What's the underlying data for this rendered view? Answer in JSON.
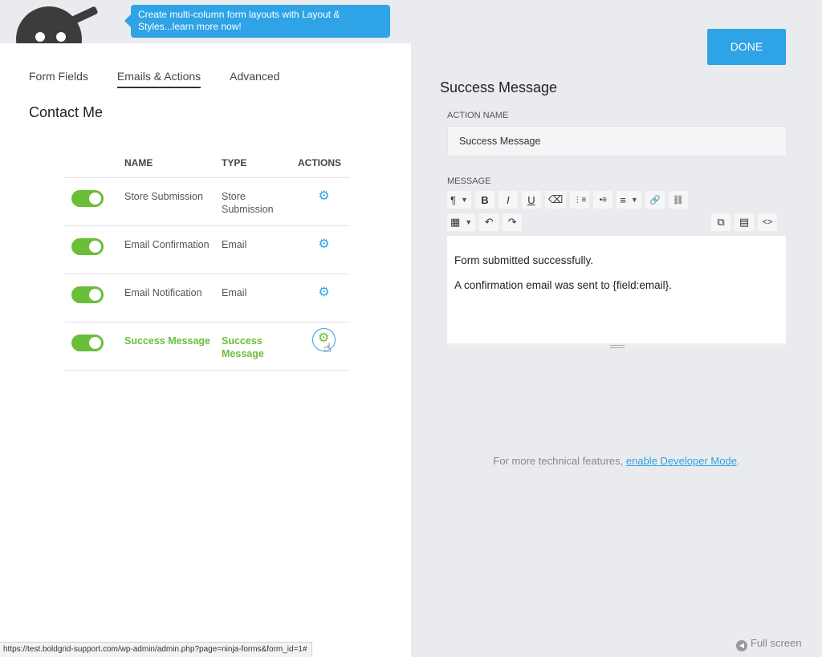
{
  "tooltip": {
    "text": "Create multi-column form layouts with Layout & Styles...learn more now!"
  },
  "tabs": [
    {
      "label": "Form Fields"
    },
    {
      "label": "Emails & Actions",
      "active": true
    },
    {
      "label": "Advanced"
    }
  ],
  "form": {
    "title": "Contact Me"
  },
  "table": {
    "headers": {
      "name": "NAME",
      "type": "TYPE",
      "actions": "ACTIONS"
    },
    "rows": [
      {
        "name": "Store Submission",
        "type": "Store Submission",
        "enabled": true
      },
      {
        "name": "Email Confirmation",
        "type": "Email",
        "enabled": true
      },
      {
        "name": "Email Notification",
        "type": "Email",
        "enabled": true
      },
      {
        "name": "Success Message",
        "type": "Success Message",
        "enabled": true,
        "active": true
      }
    ]
  },
  "status_url": "https://test.boldgrid-support.com/wp-admin/admin.php?page=ninja-forms&form_id=1#",
  "right": {
    "done_label": "DONE",
    "title": "Success Message",
    "action_name_label": "ACTION NAME",
    "action_name_value": "Success Message",
    "message_label": "MESSAGE",
    "message_lines": [
      "Form submitted successfully.",
      "A confirmation email was sent to {field:email}."
    ],
    "dev_note_prefix": "For more technical features, ",
    "dev_note_link": "enable Developer Mode",
    "dev_note_suffix": ".",
    "fullscreen_label": "Full screen"
  },
  "toolbar": {
    "paragraph": "¶",
    "bold": "B",
    "italic": "I",
    "underline": "U",
    "eraser": "⌫",
    "ol": "⋮≡",
    "ul": "•≡",
    "align": "≡",
    "link": "🔗",
    "unlink": "⛓",
    "table": "▦",
    "undo": "↶",
    "redo": "↷",
    "media": "⧉",
    "page": "▤",
    "code": "<>"
  },
  "colors": {
    "accent": "#2ea3e6",
    "green": "#6abe3a",
    "panel_bg": "#e9ebee"
  }
}
